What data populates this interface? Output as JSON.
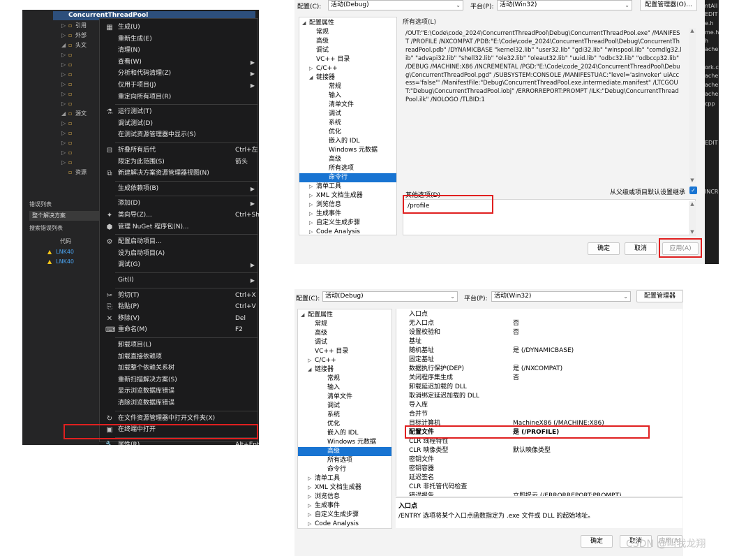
{
  "panel1": {
    "project_name": "ConcurrentThreadPool",
    "tree": [
      {
        "arrow": "▷",
        "icon": "▫",
        "label": "引用"
      },
      {
        "arrow": "▷",
        "icon": "▫",
        "label": "外部"
      },
      {
        "arrow": "◢",
        "icon": "▫",
        "label": "头文"
      },
      {
        "arrow": "▷",
        "icon": "▫",
        "label": ""
      },
      {
        "arrow": "▷",
        "icon": "▫",
        "label": ""
      },
      {
        "arrow": "▷",
        "icon": "▫",
        "label": ""
      },
      {
        "arrow": "▷",
        "icon": "▫",
        "label": ""
      },
      {
        "arrow": "▷",
        "icon": "▫",
        "label": ""
      },
      {
        "arrow": "▷",
        "icon": "▫",
        "label": ""
      },
      {
        "arrow": "◢",
        "icon": "▫",
        "label": "源文"
      },
      {
        "arrow": "▷",
        "icon": "▫",
        "label": ""
      },
      {
        "arrow": "▷",
        "icon": "▫",
        "label": ""
      },
      {
        "arrow": "▷",
        "icon": "▫",
        "label": ""
      },
      {
        "arrow": "▷",
        "icon": "▫",
        "label": ""
      },
      {
        "arrow": "▷",
        "icon": "▫",
        "label": ""
      },
      {
        "arrow": "",
        "icon": "▫",
        "label": "资源"
      }
    ],
    "error_list_title": "错误列表",
    "error_scope": "整个解决方案",
    "search_error_list": "搜索错误列表",
    "code_col": "代码",
    "warnings": [
      "LNK40",
      "LNK40"
    ],
    "menu": [
      {
        "icon": "▦",
        "label": "生成(U)",
        "shortcut": "",
        "sub": false
      },
      {
        "icon": "",
        "label": "重新生成(E)",
        "shortcut": "",
        "sub": false
      },
      {
        "icon": "",
        "label": "清理(N)",
        "shortcut": "",
        "sub": false
      },
      {
        "icon": "",
        "label": "查看(W)",
        "shortcut": "",
        "sub": true
      },
      {
        "icon": "",
        "label": "分析和代码清理(Z)",
        "shortcut": "",
        "sub": true
      },
      {
        "icon": "",
        "label": "仅用于项目(J)",
        "shortcut": "",
        "sub": true
      },
      {
        "icon": "",
        "label": "重定向所有项目(R)",
        "shortcut": "",
        "sub": false
      },
      {
        "sep": true
      },
      {
        "icon": "⚗",
        "label": "运行测试(T)",
        "shortcut": "",
        "sub": false
      },
      {
        "icon": "",
        "label": "调试测试(D)",
        "shortcut": "",
        "sub": false
      },
      {
        "icon": "",
        "label": "在测试资源管理器中显示(S)",
        "shortcut": "",
        "sub": false
      },
      {
        "sep": true
      },
      {
        "icon": "⊟",
        "label": "折叠所有后代",
        "shortcut": "Ctrl+左箭头",
        "sub": false
      },
      {
        "icon": "",
        "label": "限定为此范围(S)",
        "shortcut": "",
        "sub": false
      },
      {
        "icon": "⧉",
        "label": "新建解决方案资源管理器视图(N)",
        "shortcut": "",
        "sub": false
      },
      {
        "sep": true
      },
      {
        "icon": "",
        "label": "生成依赖项(B)",
        "shortcut": "",
        "sub": true
      },
      {
        "sep": true
      },
      {
        "icon": "",
        "label": "添加(D)",
        "shortcut": "",
        "sub": true
      },
      {
        "icon": "✦",
        "label": "类向导(Z)...",
        "shortcut": "Ctrl+Shift+X",
        "sub": false
      },
      {
        "icon": "⬢",
        "label": "管理 NuGet 程序包(N)...",
        "shortcut": "",
        "sub": false
      },
      {
        "sep": true
      },
      {
        "icon": "⚙",
        "label": "配置启动项目...",
        "shortcut": "",
        "sub": false
      },
      {
        "icon": "",
        "label": "设为启动项目(A)",
        "shortcut": "",
        "sub": false
      },
      {
        "icon": "",
        "label": "调试(G)",
        "shortcut": "",
        "sub": true
      },
      {
        "sep": true
      },
      {
        "icon": "",
        "label": "Git(I)",
        "shortcut": "",
        "sub": true
      },
      {
        "sep": true
      },
      {
        "icon": "✂",
        "label": "剪切(T)",
        "shortcut": "Ctrl+X",
        "sub": false
      },
      {
        "icon": "⎘",
        "label": "粘贴(P)",
        "shortcut": "Ctrl+V",
        "sub": false
      },
      {
        "icon": "✕",
        "label": "移除(V)",
        "shortcut": "Del",
        "sub": false
      },
      {
        "icon": "⌨",
        "label": "重命名(M)",
        "shortcut": "F2",
        "sub": false
      },
      {
        "sep": true
      },
      {
        "icon": "",
        "label": "卸载项目(L)",
        "shortcut": "",
        "sub": false
      },
      {
        "icon": "",
        "label": "加载直接依赖项",
        "shortcut": "",
        "sub": false
      },
      {
        "icon": "",
        "label": "加载整个依赖关系树",
        "shortcut": "",
        "sub": false
      },
      {
        "icon": "",
        "label": "重新扫描解决方案(S)",
        "shortcut": "",
        "sub": false
      },
      {
        "icon": "",
        "label": "显示浏览数据库错误",
        "shortcut": "",
        "sub": false
      },
      {
        "icon": "",
        "label": "清除浏览数据库错误",
        "shortcut": "",
        "sub": false
      },
      {
        "sep": true
      },
      {
        "icon": "↻",
        "label": "在文件资源管理器中打开文件夹(X)",
        "shortcut": "",
        "sub": false
      },
      {
        "icon": "▣",
        "label": "在终端中打开",
        "shortcut": "",
        "sub": false
      },
      {
        "sep": true
      },
      {
        "icon": "🔧",
        "label": "属性(R)",
        "shortcut": "Alt+Enter",
        "sub": false
      }
    ]
  },
  "panel2": {
    "config_label": "配置(C):",
    "config_value": "活动(Debug)",
    "platform_label": "平台(P):",
    "platform_value": "活动(Win32)",
    "config_manager": "配置管理器(O)...",
    "tree": [
      {
        "indent": 0,
        "toggle": "◢",
        "label": "配置属性"
      },
      {
        "indent": 1,
        "toggle": "",
        "label": "常规"
      },
      {
        "indent": 1,
        "toggle": "",
        "label": "高级"
      },
      {
        "indent": 1,
        "toggle": "",
        "label": "调试"
      },
      {
        "indent": 1,
        "toggle": "",
        "label": "VC++ 目录"
      },
      {
        "indent": 1,
        "toggle": "▷",
        "label": "C/C++"
      },
      {
        "indent": 1,
        "toggle": "◢",
        "label": "链接器"
      },
      {
        "indent": 2,
        "toggle": "",
        "label": "常规"
      },
      {
        "indent": 2,
        "toggle": "",
        "label": "输入"
      },
      {
        "indent": 2,
        "toggle": "",
        "label": "清单文件"
      },
      {
        "indent": 2,
        "toggle": "",
        "label": "调试"
      },
      {
        "indent": 2,
        "toggle": "",
        "label": "系统"
      },
      {
        "indent": 2,
        "toggle": "",
        "label": "优化"
      },
      {
        "indent": 2,
        "toggle": "",
        "label": "嵌入的 IDL"
      },
      {
        "indent": 2,
        "toggle": "",
        "label": "Windows 元数据"
      },
      {
        "indent": 2,
        "toggle": "",
        "label": "高级"
      },
      {
        "indent": 2,
        "toggle": "",
        "label": "所有选项"
      },
      {
        "indent": 2,
        "toggle": "",
        "label": "命令行",
        "selected": true
      },
      {
        "indent": 1,
        "toggle": "▷",
        "label": "清单工具"
      },
      {
        "indent": 1,
        "toggle": "▷",
        "label": "XML 文档生成器"
      },
      {
        "indent": 1,
        "toggle": "▷",
        "label": "浏览信息"
      },
      {
        "indent": 1,
        "toggle": "▷",
        "label": "生成事件"
      },
      {
        "indent": 1,
        "toggle": "▷",
        "label": "自定义生成步骤"
      },
      {
        "indent": 1,
        "toggle": "▷",
        "label": "Code Analysis"
      }
    ],
    "all_options_title": "所有选项(L)",
    "all_options_text": "/OUT:\"E:\\Code\\code_2024\\ConcurrentThreadPool\\Debug\\ConcurrentThreadPool.exe\" /MANIFEST /PROFILE /NXCOMPAT /PDB:\"E:\\Code\\code_2024\\ConcurrentThreadPool\\Debug\\ConcurrentThreadPool.pdb\" /DYNAMICBASE \"kernel32.lib\" \"user32.lib\" \"gdi32.lib\" \"winspool.lib\" \"comdlg32.lib\" \"advapi32.lib\" \"shell32.lib\" \"ole32.lib\" \"oleaut32.lib\" \"uuid.lib\" \"odbc32.lib\" \"odbccp32.lib\" /DEBUG /MACHINE:X86 /INCREMENTAL /PGD:\"E:\\Code\\code_2024\\ConcurrentThreadPool\\Debug\\ConcurrentThreadPool.pgd\" /SUBSYSTEM:CONSOLE /MANIFESTUAC:\"level='asInvoker' uiAccess='false'\" /ManifestFile:\"Debug\\ConcurrentThreadPool.exe.intermediate.manifest\" /LTCGOUT:\"Debug\\ConcurrentThreadPool.iobj\" /ERRORREPORT:PROMPT /ILK:\"Debug\\ConcurrentThreadPool.ilk\" /NOLOGO /TLBID:1",
    "other_options": "其他选项(D)",
    "inherit_label": "从父级或项目默认设置继承",
    "additional_value": "/profile",
    "ok": "确定",
    "cancel": "取消",
    "apply": "应用(A)"
  },
  "panel3": {
    "config_label": "配置(C):",
    "config_value": "活动(Debug)",
    "platform_label": "平台(P):",
    "platform_value": "活动(Win32)",
    "config_manager": "配置管理器(O)...",
    "tree": [
      {
        "indent": 0,
        "toggle": "◢",
        "label": "配置属性"
      },
      {
        "indent": 1,
        "toggle": "",
        "label": "常规"
      },
      {
        "indent": 1,
        "toggle": "",
        "label": "高级"
      },
      {
        "indent": 1,
        "toggle": "",
        "label": "调试"
      },
      {
        "indent": 1,
        "toggle": "",
        "label": "VC++ 目录"
      },
      {
        "indent": 1,
        "toggle": "▷",
        "label": "C/C++"
      },
      {
        "indent": 1,
        "toggle": "◢",
        "label": "链接器"
      },
      {
        "indent": 2,
        "toggle": "",
        "label": "常规"
      },
      {
        "indent": 2,
        "toggle": "",
        "label": "输入"
      },
      {
        "indent": 2,
        "toggle": "",
        "label": "清单文件"
      },
      {
        "indent": 2,
        "toggle": "",
        "label": "调试"
      },
      {
        "indent": 2,
        "toggle": "",
        "label": "系统"
      },
      {
        "indent": 2,
        "toggle": "",
        "label": "优化"
      },
      {
        "indent": 2,
        "toggle": "",
        "label": "嵌入的 IDL"
      },
      {
        "indent": 2,
        "toggle": "",
        "label": "Windows 元数据"
      },
      {
        "indent": 2,
        "toggle": "",
        "label": "高级",
        "selected": true
      },
      {
        "indent": 2,
        "toggle": "",
        "label": "所有选项"
      },
      {
        "indent": 2,
        "toggle": "",
        "label": "命令行"
      },
      {
        "indent": 1,
        "toggle": "▷",
        "label": "清单工具"
      },
      {
        "indent": 1,
        "toggle": "▷",
        "label": "XML 文档生成器"
      },
      {
        "indent": 1,
        "toggle": "▷",
        "label": "浏览信息"
      },
      {
        "indent": 1,
        "toggle": "▷",
        "label": "生成事件"
      },
      {
        "indent": 1,
        "toggle": "▷",
        "label": "自定义生成步骤"
      },
      {
        "indent": 1,
        "toggle": "▷",
        "label": "Code Analysis"
      }
    ],
    "rows": [
      {
        "key": "入口点",
        "value": ""
      },
      {
        "key": "无入口点",
        "value": "否"
      },
      {
        "key": "设置校验和",
        "value": "否"
      },
      {
        "key": "基址",
        "value": ""
      },
      {
        "key": "随机基址",
        "value": "是 (/DYNAMICBASE)"
      },
      {
        "key": "固定基址",
        "value": ""
      },
      {
        "key": "数据执行保护(DEP)",
        "value": "是 (/NXCOMPAT)"
      },
      {
        "key": "关闭程序集生成",
        "value": "否"
      },
      {
        "key": "卸载延迟加载的 DLL",
        "value": ""
      },
      {
        "key": "取消绑定延迟加载的 DLL",
        "value": ""
      },
      {
        "key": "导入库",
        "value": ""
      },
      {
        "key": "合并节",
        "value": ""
      },
      {
        "key": "目标计算机",
        "value": "MachineX86 (/MACHINE:X86)"
      },
      {
        "key": "配置文件",
        "value": "是 (/PROFILE)",
        "bold": true
      },
      {
        "key": "CLR 线程特性",
        "value": ""
      },
      {
        "key": "CLR 映像类型",
        "value": "默认映像类型"
      },
      {
        "key": "密钥文件",
        "value": ""
      },
      {
        "key": "密钥容器",
        "value": ""
      },
      {
        "key": "延迟签名",
        "value": ""
      },
      {
        "key": "CLR 非托管代码检查",
        "value": ""
      },
      {
        "key": "错误报告",
        "value": "立即提示 (/ERRORREPORT:PROMPT)"
      }
    ],
    "desc_title": "入口点",
    "desc_text": "/ENTRY 选项将某个入口点函数指定为 .exe 文件或 DLL 的起始地址。",
    "ok": "确定",
    "cancel": "取消",
    "apply": "应用(A)"
  },
  "strip": [
    "ntAll",
    "EDIT",
    "e.h",
    "me.h",
    "h",
    "ache",
    "ork.cp",
    "ache",
    "ache",
    "ache",
    "cpp",
    "EDIT",
    "INCR"
  ],
  "watermark": "CSDN @叫我龙翔"
}
